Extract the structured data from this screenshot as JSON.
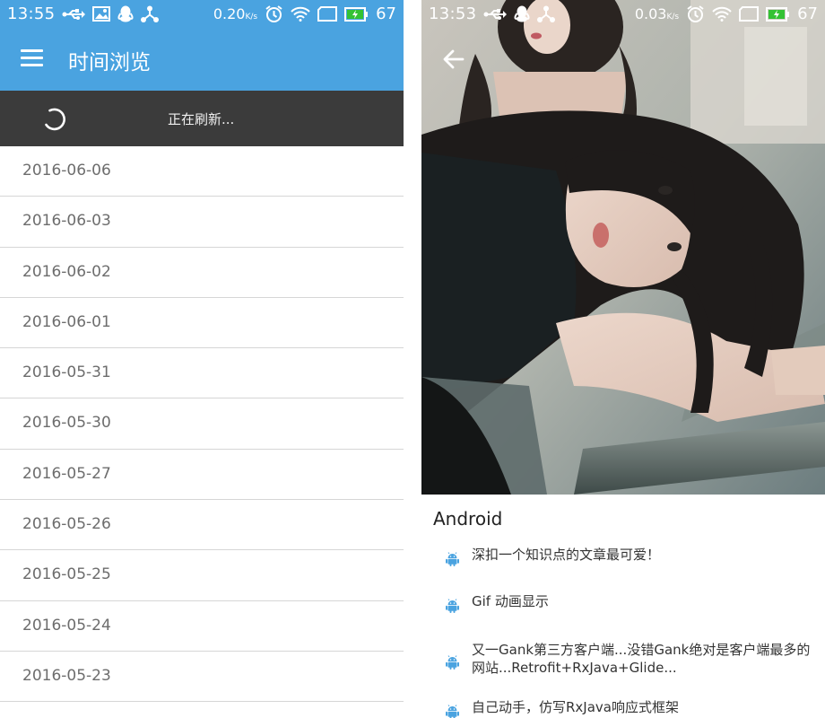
{
  "left_screen": {
    "status_bar": {
      "time": "13:55",
      "speed": "0.20",
      "speed_unit": "K/s",
      "battery": "67"
    },
    "app_bar": {
      "title": "时间浏览"
    },
    "refresh": {
      "text": "正在刷新..."
    },
    "dates": [
      "2016-06-06",
      "2016-06-03",
      "2016-06-02",
      "2016-06-01",
      "2016-05-31",
      "2016-05-30",
      "2016-05-27",
      "2016-05-26",
      "2016-05-25",
      "2016-05-24",
      "2016-05-23"
    ]
  },
  "right_screen": {
    "status_bar": {
      "time": "13:53",
      "speed": "0.03",
      "speed_unit": "K/s",
      "battery": "67"
    },
    "section_title": "Android",
    "articles": [
      "深扣一个知识点的文章最可爱！",
      "Gif 动画显示",
      "又一Gank第三方客户端...没错Gank绝对是客户端最多的网站...Retrofit+RxJava+Glide...",
      "自己动手，仿写RxJava响应式框架"
    ]
  },
  "colors": {
    "app_bar": "#4aa3e0",
    "refresh_bar": "#3b3b3b",
    "list_text": "#6d6d6d",
    "divider": "#d6d6d6",
    "android_icon": "#4aa3e0"
  }
}
